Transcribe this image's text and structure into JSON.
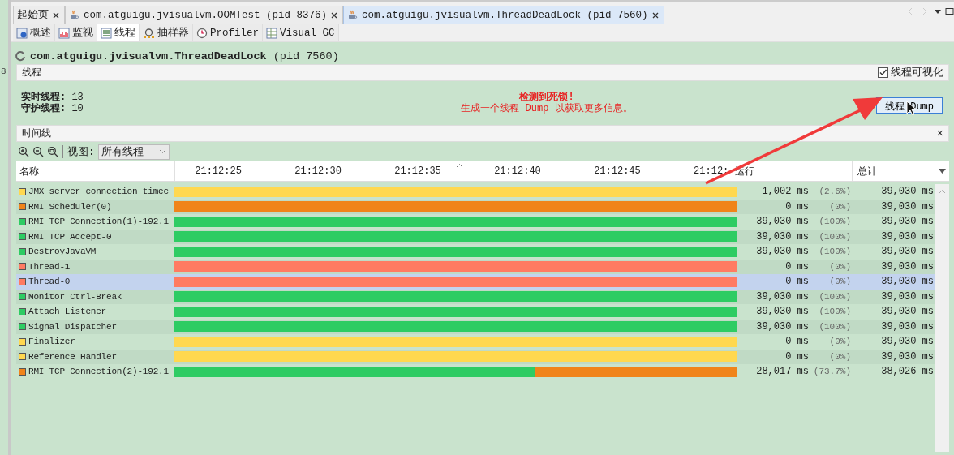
{
  "side_strip": {
    "label": "8"
  },
  "tabs": [
    {
      "label": "起始页",
      "icon": false,
      "selected": false
    },
    {
      "label": "com.atguigu.jvisualvm.OOMTest (pid 8376)",
      "icon": true,
      "selected": false
    },
    {
      "label": "com.atguigu.jvisualvm.ThreadDeadLock (pid 7560)",
      "icon": true,
      "selected": true
    }
  ],
  "subtabs": [
    {
      "label": "概述",
      "kind": "info",
      "selected": false
    },
    {
      "label": "监视",
      "kind": "chart",
      "selected": false
    },
    {
      "label": "线程",
      "kind": "list",
      "selected": true
    },
    {
      "label": "抽样器",
      "kind": "sampler",
      "selected": false
    },
    {
      "label": "Profiler",
      "kind": "clock",
      "selected": false
    },
    {
      "label": "Visual GC",
      "kind": "gc",
      "selected": false
    }
  ],
  "title": {
    "name": "com.atguigu.jvisualvm.ThreadDeadLock",
    "pid": "(pid 7560)"
  },
  "threads_section": {
    "label": "线程",
    "visualize": {
      "label": "线程可视化",
      "checked": true
    }
  },
  "stats": [
    {
      "label": "实时线程:",
      "value": "13"
    },
    {
      "label": "守护线程:",
      "value": "10"
    }
  ],
  "alert": {
    "title": "检测到死锁!",
    "message": "生成一个线程 Dump 以获取更多信息。"
  },
  "dump_button": "线程 Dump",
  "timeline_section": {
    "label": "时间线",
    "close": "×"
  },
  "toolbar": {
    "view_label": "视图:",
    "view_value": "所有线程"
  },
  "table": {
    "columns": {
      "name": "名称",
      "run": "运行",
      "total": "总计"
    },
    "ticks": [
      "21:12:25",
      "21:12:30",
      "21:12:35",
      "21:12:40",
      "21:12:45",
      "21:12:"
    ],
    "rows": [
      {
        "name": "JMX server connection timec",
        "color": "#ffd84f",
        "selected": false,
        "timeline": [
          {
            "color": "#ffd84f",
            "level": 1
          }
        ],
        "run": "1,002 ms",
        "pct": "(2.6%)",
        "total": "39,030 ms"
      },
      {
        "name": "RMI Scheduler(0)",
        "color": "#f0841a",
        "selected": false,
        "timeline": [
          {
            "color": "#f0841a",
            "level": 1
          }
        ],
        "run": "0 ms",
        "pct": "(0%)",
        "total": "39,030 ms"
      },
      {
        "name": "RMI TCP Connection(1)-192.1",
        "color": "#2ecc63",
        "selected": false,
        "timeline": [
          {
            "color": "#2ecc63",
            "level": 1
          }
        ],
        "run": "39,030 ms",
        "pct": "(100%)",
        "total": "39,030 ms"
      },
      {
        "name": "RMI TCP Accept-0",
        "color": "#2ecc63",
        "selected": false,
        "timeline": [
          {
            "color": "#2ecc63",
            "level": 1
          }
        ],
        "run": "39,030 ms",
        "pct": "(100%)",
        "total": "39,030 ms"
      },
      {
        "name": "DestroyJavaVM",
        "color": "#2ecc63",
        "selected": false,
        "timeline": [
          {
            "color": "#2ecc63",
            "level": 1
          }
        ],
        "run": "39,030 ms",
        "pct": "(100%)",
        "total": "39,030 ms"
      },
      {
        "name": "Thread-1",
        "color": "#ff7b62",
        "selected": false,
        "timeline": [
          {
            "color": "#ff7b62",
            "level": 1
          }
        ],
        "run": "0 ms",
        "pct": "(0%)",
        "total": "39,030 ms"
      },
      {
        "name": "Thread-0",
        "color": "#ff7b62",
        "selected": true,
        "timeline": [
          {
            "color": "#ff7b62",
            "level": 1
          }
        ],
        "run": "0 ms",
        "pct": "(0%)",
        "total": "39,030 ms"
      },
      {
        "name": "Monitor Ctrl-Break",
        "color": "#2ecc63",
        "selected": false,
        "timeline": [
          {
            "color": "#2ecc63",
            "level": 1
          }
        ],
        "run": "39,030 ms",
        "pct": "(100%)",
        "total": "39,030 ms"
      },
      {
        "name": "Attach Listener",
        "color": "#2ecc63",
        "selected": false,
        "timeline": [
          {
            "color": "#2ecc63",
            "level": 1
          }
        ],
        "run": "39,030 ms",
        "pct": "(100%)",
        "total": "39,030 ms"
      },
      {
        "name": "Signal Dispatcher",
        "color": "#2ecc63",
        "selected": false,
        "timeline": [
          {
            "color": "#2ecc63",
            "level": 1
          }
        ],
        "run": "39,030 ms",
        "pct": "(100%)",
        "total": "39,030 ms"
      },
      {
        "name": "Finalizer",
        "color": "#ffd84f",
        "selected": false,
        "timeline": [
          {
            "color": "#ffd84f",
            "level": 1
          }
        ],
        "run": "0 ms",
        "pct": "(0%)",
        "total": "39,030 ms"
      },
      {
        "name": "Reference Handler",
        "color": "#ffd84f",
        "selected": false,
        "timeline": [
          {
            "color": "#ffd84f",
            "level": 1
          }
        ],
        "run": "0 ms",
        "pct": "(0%)",
        "total": "39,030 ms"
      },
      {
        "name": "RMI TCP Connection(2)-192.1",
        "color": "#f0841a",
        "selected": false,
        "timeline": [
          {
            "color": "#2ecc63",
            "level": 0.64
          }
        ],
        "tail": {
          "color": "#f0841a"
        },
        "run": "28,017 ms",
        "pct": "(73.7%)",
        "total": "38,026 ms"
      }
    ]
  }
}
